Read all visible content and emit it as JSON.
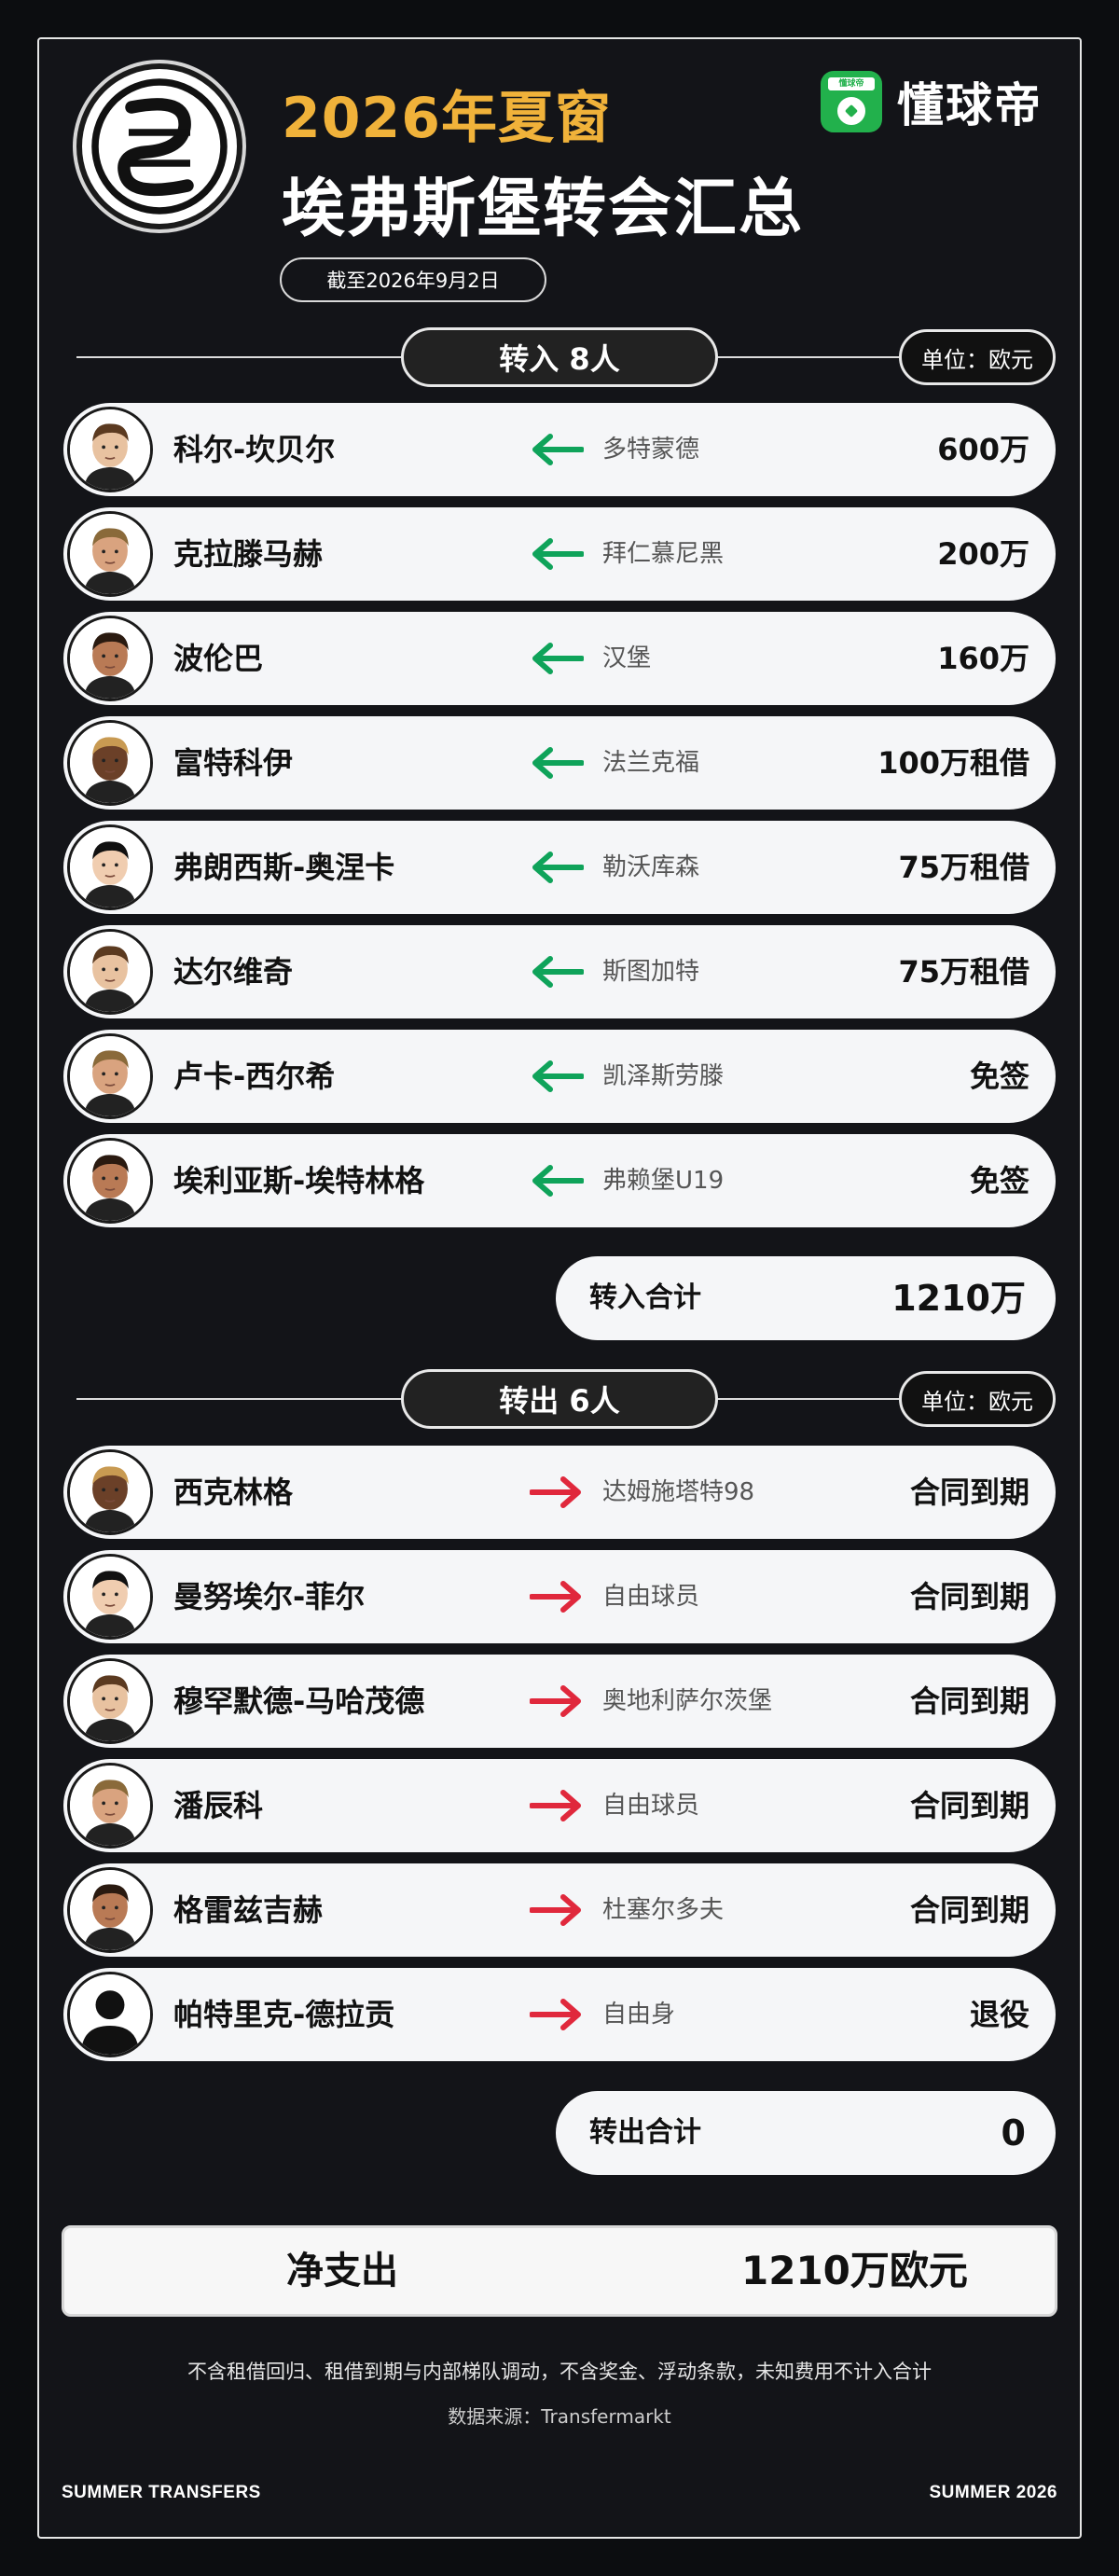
{
  "header": {
    "season_title": "2026年夏窗",
    "main_title": "埃弗斯堡转会汇总",
    "date": "截至2026年9月2日",
    "brand_name": "懂球帝",
    "brand_icon_text": "懂球帝"
  },
  "transfers_in": {
    "heading": "转入 8人",
    "unit": "单位：欧元",
    "players": [
      {
        "name": "科尔-坎贝尔",
        "club": "多特蒙德",
        "fee": "600万"
      },
      {
        "name": "克拉滕马赫",
        "club": "拜仁慕尼黑",
        "fee": "200万"
      },
      {
        "name": "波伦巴",
        "club": "汉堡",
        "fee": "160万"
      },
      {
        "name": "富特科伊",
        "club": "法兰克福",
        "fee": "100万租借"
      },
      {
        "name": "弗朗西斯-奥涅卡",
        "club": "勒沃库森",
        "fee": "75万租借"
      },
      {
        "name": "达尔维奇",
        "club": "斯图加特",
        "fee": "75万租借"
      },
      {
        "name": "卢卡-西尔希",
        "club": "凯泽斯劳滕",
        "fee": "免签"
      },
      {
        "name": "埃利亚斯-埃特林格",
        "club": "弗赖堡U19",
        "fee": "免签"
      }
    ],
    "total_label": "转入合计",
    "total_value": "1210万"
  },
  "transfers_out": {
    "heading": "转出 6人",
    "unit": "单位：欧元",
    "players": [
      {
        "name": "西克林格",
        "club": "达姆施塔特98",
        "fee": "合同到期"
      },
      {
        "name": "曼努埃尔-菲尔",
        "club": "自由球员",
        "fee": "合同到期"
      },
      {
        "name": "穆罕默德-马哈茂德",
        "club": "奥地利萨尔茨堡",
        "fee": "合同到期"
      },
      {
        "name": "潘辰科",
        "club": "自由球员",
        "fee": "合同到期"
      },
      {
        "name": "格雷兹吉赫",
        "club": "杜塞尔多夫",
        "fee": "合同到期"
      },
      {
        "name": "帕特里克-德拉贡",
        "club": "自由身",
        "fee": "退役"
      }
    ],
    "total_label": "转出合计",
    "total_value": "0"
  },
  "net": {
    "label": "净支出",
    "value": "1210万欧元"
  },
  "footer": {
    "note": "不含租借回归、租借到期与内部梯队调动，不含奖金、浮动条款，未知费用不计入合计",
    "source": "数据来源：Transfermarkt",
    "left_tag": "SUMMER TRANSFERS",
    "right_tag": "SUMMER 2026"
  },
  "colors": {
    "in_arrow": "#0fa35a",
    "out_arrow": "#e0283c",
    "accent_gold": "#f0b23a",
    "brand_green": "#22b14c"
  }
}
